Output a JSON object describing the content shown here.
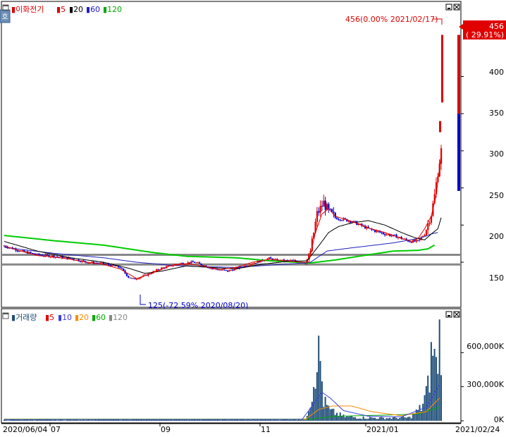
{
  "colors": {
    "up": "#e00000",
    "down": "#0000d0",
    "ma5": "#e00000",
    "ma20": "#000000",
    "ma60": "#2020c0",
    "ma120": "#00cc00",
    "vol_bar": "#1f4e79",
    "vol_ma10": "#4040e0",
    "vol_ma20": "#ff8c00",
    "vol_ma60": "#00aa00",
    "vol_ma120": "#888888",
    "grid": "#000000"
  },
  "price_panel": {
    "legend": {
      "name": "이화전기",
      "items": [
        "5",
        "20",
        "60",
        "120"
      ]
    },
    "high_annotation": "456(0.00% 2021/02/17)",
    "low_annotation": "125(-72.59% 2020/08/20)",
    "current_price": "456",
    "current_change": "( 29.91%)",
    "y_ticks": [
      "400",
      "350",
      "300",
      "250",
      "200",
      "150"
    ],
    "side_icon": "호"
  },
  "volume_panel": {
    "legend": {
      "name": "거래량",
      "items": [
        "5",
        "10",
        "20",
        "60",
        "120"
      ]
    },
    "y_ticks": [
      "600,000K",
      "300,000K",
      "0K"
    ]
  },
  "x_labels": [
    "2020/06/04",
    "07",
    "09",
    "11",
    "2021/01",
    "2021/02/24"
  ],
  "chart_data": {
    "type": "candlestick",
    "price_ylim": [
      95,
      465
    ],
    "volume_ylim": [
      0,
      850000
    ],
    "horizontal_lines": [
      160,
      147
    ],
    "high": {
      "value": 456,
      "date": "2021/02/17"
    },
    "low": {
      "value": 125,
      "date": "2020/08/20"
    },
    "current": 456,
    "last_bar": {
      "open": 246,
      "close": 456,
      "low": 246,
      "high": 456,
      "split": 350
    },
    "price_key": [
      [
        0,
        172
      ],
      [
        10,
        165
      ],
      [
        20,
        160
      ],
      [
        30,
        158
      ],
      [
        40,
        155
      ],
      [
        50,
        150
      ],
      [
        60,
        148
      ],
      [
        70,
        143
      ],
      [
        75,
        130
      ],
      [
        78,
        127
      ],
      [
        85,
        132
      ],
      [
        95,
        142
      ],
      [
        105,
        148
      ],
      [
        115,
        150
      ],
      [
        120,
        146
      ],
      [
        125,
        142
      ],
      [
        135,
        138
      ],
      [
        145,
        145
      ],
      [
        155,
        152
      ],
      [
        160,
        155
      ],
      [
        165,
        152
      ],
      [
        175,
        152
      ],
      [
        182,
        149
      ],
      [
        185,
        165
      ],
      [
        189,
        215
      ],
      [
        193,
        230
      ],
      [
        196,
        218
      ],
      [
        200,
        210
      ],
      [
        210,
        205
      ],
      [
        220,
        195
      ],
      [
        230,
        188
      ],
      [
        238,
        184
      ],
      [
        245,
        178
      ],
      [
        250,
        178
      ],
      [
        254,
        188
      ],
      [
        258,
        215
      ],
      [
        260,
        240
      ],
      [
        262,
        272
      ],
      [
        264,
        300
      ]
    ],
    "ma5": [
      [
        0,
        172
      ],
      [
        10,
        165
      ],
      [
        20,
        159
      ],
      [
        30,
        157
      ],
      [
        40,
        154
      ],
      [
        50,
        150
      ],
      [
        60,
        147
      ],
      [
        70,
        141
      ],
      [
        80,
        128
      ],
      [
        90,
        136
      ],
      [
        100,
        145
      ],
      [
        110,
        148
      ],
      [
        120,
        145
      ],
      [
        130,
        140
      ],
      [
        140,
        143
      ],
      [
        150,
        150
      ],
      [
        160,
        154
      ],
      [
        170,
        152
      ],
      [
        180,
        150
      ],
      [
        184,
        150
      ],
      [
        188,
        190
      ],
      [
        192,
        215
      ],
      [
        196,
        222
      ],
      [
        200,
        212
      ],
      [
        210,
        205
      ],
      [
        220,
        196
      ],
      [
        230,
        190
      ],
      [
        240,
        182
      ],
      [
        246,
        178
      ],
      [
        250,
        182
      ],
      [
        254,
        195
      ],
      [
        258,
        212
      ],
      [
        261,
        240
      ],
      [
        264,
        295
      ]
    ],
    "ma20": [
      [
        0,
        178
      ],
      [
        20,
        165
      ],
      [
        40,
        156
      ],
      [
        60,
        150
      ],
      [
        75,
        142
      ],
      [
        85,
        135
      ],
      [
        95,
        138
      ],
      [
        110,
        145
      ],
      [
        125,
        143
      ],
      [
        140,
        141
      ],
      [
        155,
        147
      ],
      [
        170,
        151
      ],
      [
        183,
        152
      ],
      [
        190,
        172
      ],
      [
        196,
        190
      ],
      [
        202,
        198
      ],
      [
        210,
        203
      ],
      [
        220,
        206
      ],
      [
        230,
        200
      ],
      [
        240,
        190
      ],
      [
        248,
        183
      ],
      [
        254,
        180
      ],
      [
        258,
        188
      ],
      [
        262,
        195
      ],
      [
        264,
        210
      ]
    ],
    "ma60": [
      [
        0,
        170
      ],
      [
        30,
        162
      ],
      [
        60,
        156
      ],
      [
        80,
        150
      ],
      [
        100,
        146
      ],
      [
        120,
        144
      ],
      [
        140,
        143
      ],
      [
        160,
        146
      ],
      [
        175,
        148
      ],
      [
        185,
        150
      ],
      [
        195,
        165
      ],
      [
        205,
        168
      ],
      [
        220,
        172
      ],
      [
        235,
        176
      ],
      [
        245,
        180
      ],
      [
        252,
        183
      ],
      [
        258,
        188
      ],
      [
        262,
        190
      ]
    ],
    "ma120": [
      [
        0,
        186
      ],
      [
        30,
        179
      ],
      [
        60,
        173
      ],
      [
        90,
        163
      ],
      [
        110,
        158
      ],
      [
        140,
        156
      ],
      [
        160,
        152
      ],
      [
        185,
        149
      ],
      [
        200,
        153
      ],
      [
        220,
        160
      ],
      [
        235,
        165
      ],
      [
        250,
        166
      ],
      [
        256,
        168
      ],
      [
        260,
        173
      ]
    ],
    "volume_key": [
      [
        0,
        8000
      ],
      [
        40,
        8000
      ],
      [
        80,
        12000
      ],
      [
        120,
        12000
      ],
      [
        150,
        10000
      ],
      [
        182,
        12000
      ],
      [
        186,
        250000
      ],
      [
        189,
        640000
      ],
      [
        191,
        540000
      ],
      [
        193,
        180000
      ],
      [
        197,
        90000
      ],
      [
        205,
        40000
      ],
      [
        215,
        30000
      ],
      [
        230,
        25000
      ],
      [
        245,
        30000
      ],
      [
        252,
        120000
      ],
      [
        256,
        300000
      ],
      [
        259,
        700000
      ],
      [
        261,
        480000
      ],
      [
        263,
        780000
      ]
    ],
    "vol_ma10": [
      [
        0,
        10000
      ],
      [
        180,
        12000
      ],
      [
        187,
        150000
      ],
      [
        192,
        250000
      ],
      [
        197,
        200000
      ],
      [
        205,
        90000
      ],
      [
        220,
        40000
      ],
      [
        240,
        35000
      ],
      [
        255,
        120000
      ],
      [
        263,
        320000
      ]
    ],
    "vol_ma20": [
      [
        0,
        12000
      ],
      [
        182,
        12000
      ],
      [
        190,
        100000
      ],
      [
        198,
        130000
      ],
      [
        210,
        130000
      ],
      [
        222,
        80000
      ],
      [
        240,
        45000
      ],
      [
        255,
        80000
      ],
      [
        263,
        200000
      ]
    ],
    "vol_ma60": [
      [
        0,
        15000
      ],
      [
        185,
        15000
      ],
      [
        200,
        40000
      ],
      [
        230,
        50000
      ],
      [
        250,
        60000
      ],
      [
        263,
        120000
      ]
    ]
  }
}
